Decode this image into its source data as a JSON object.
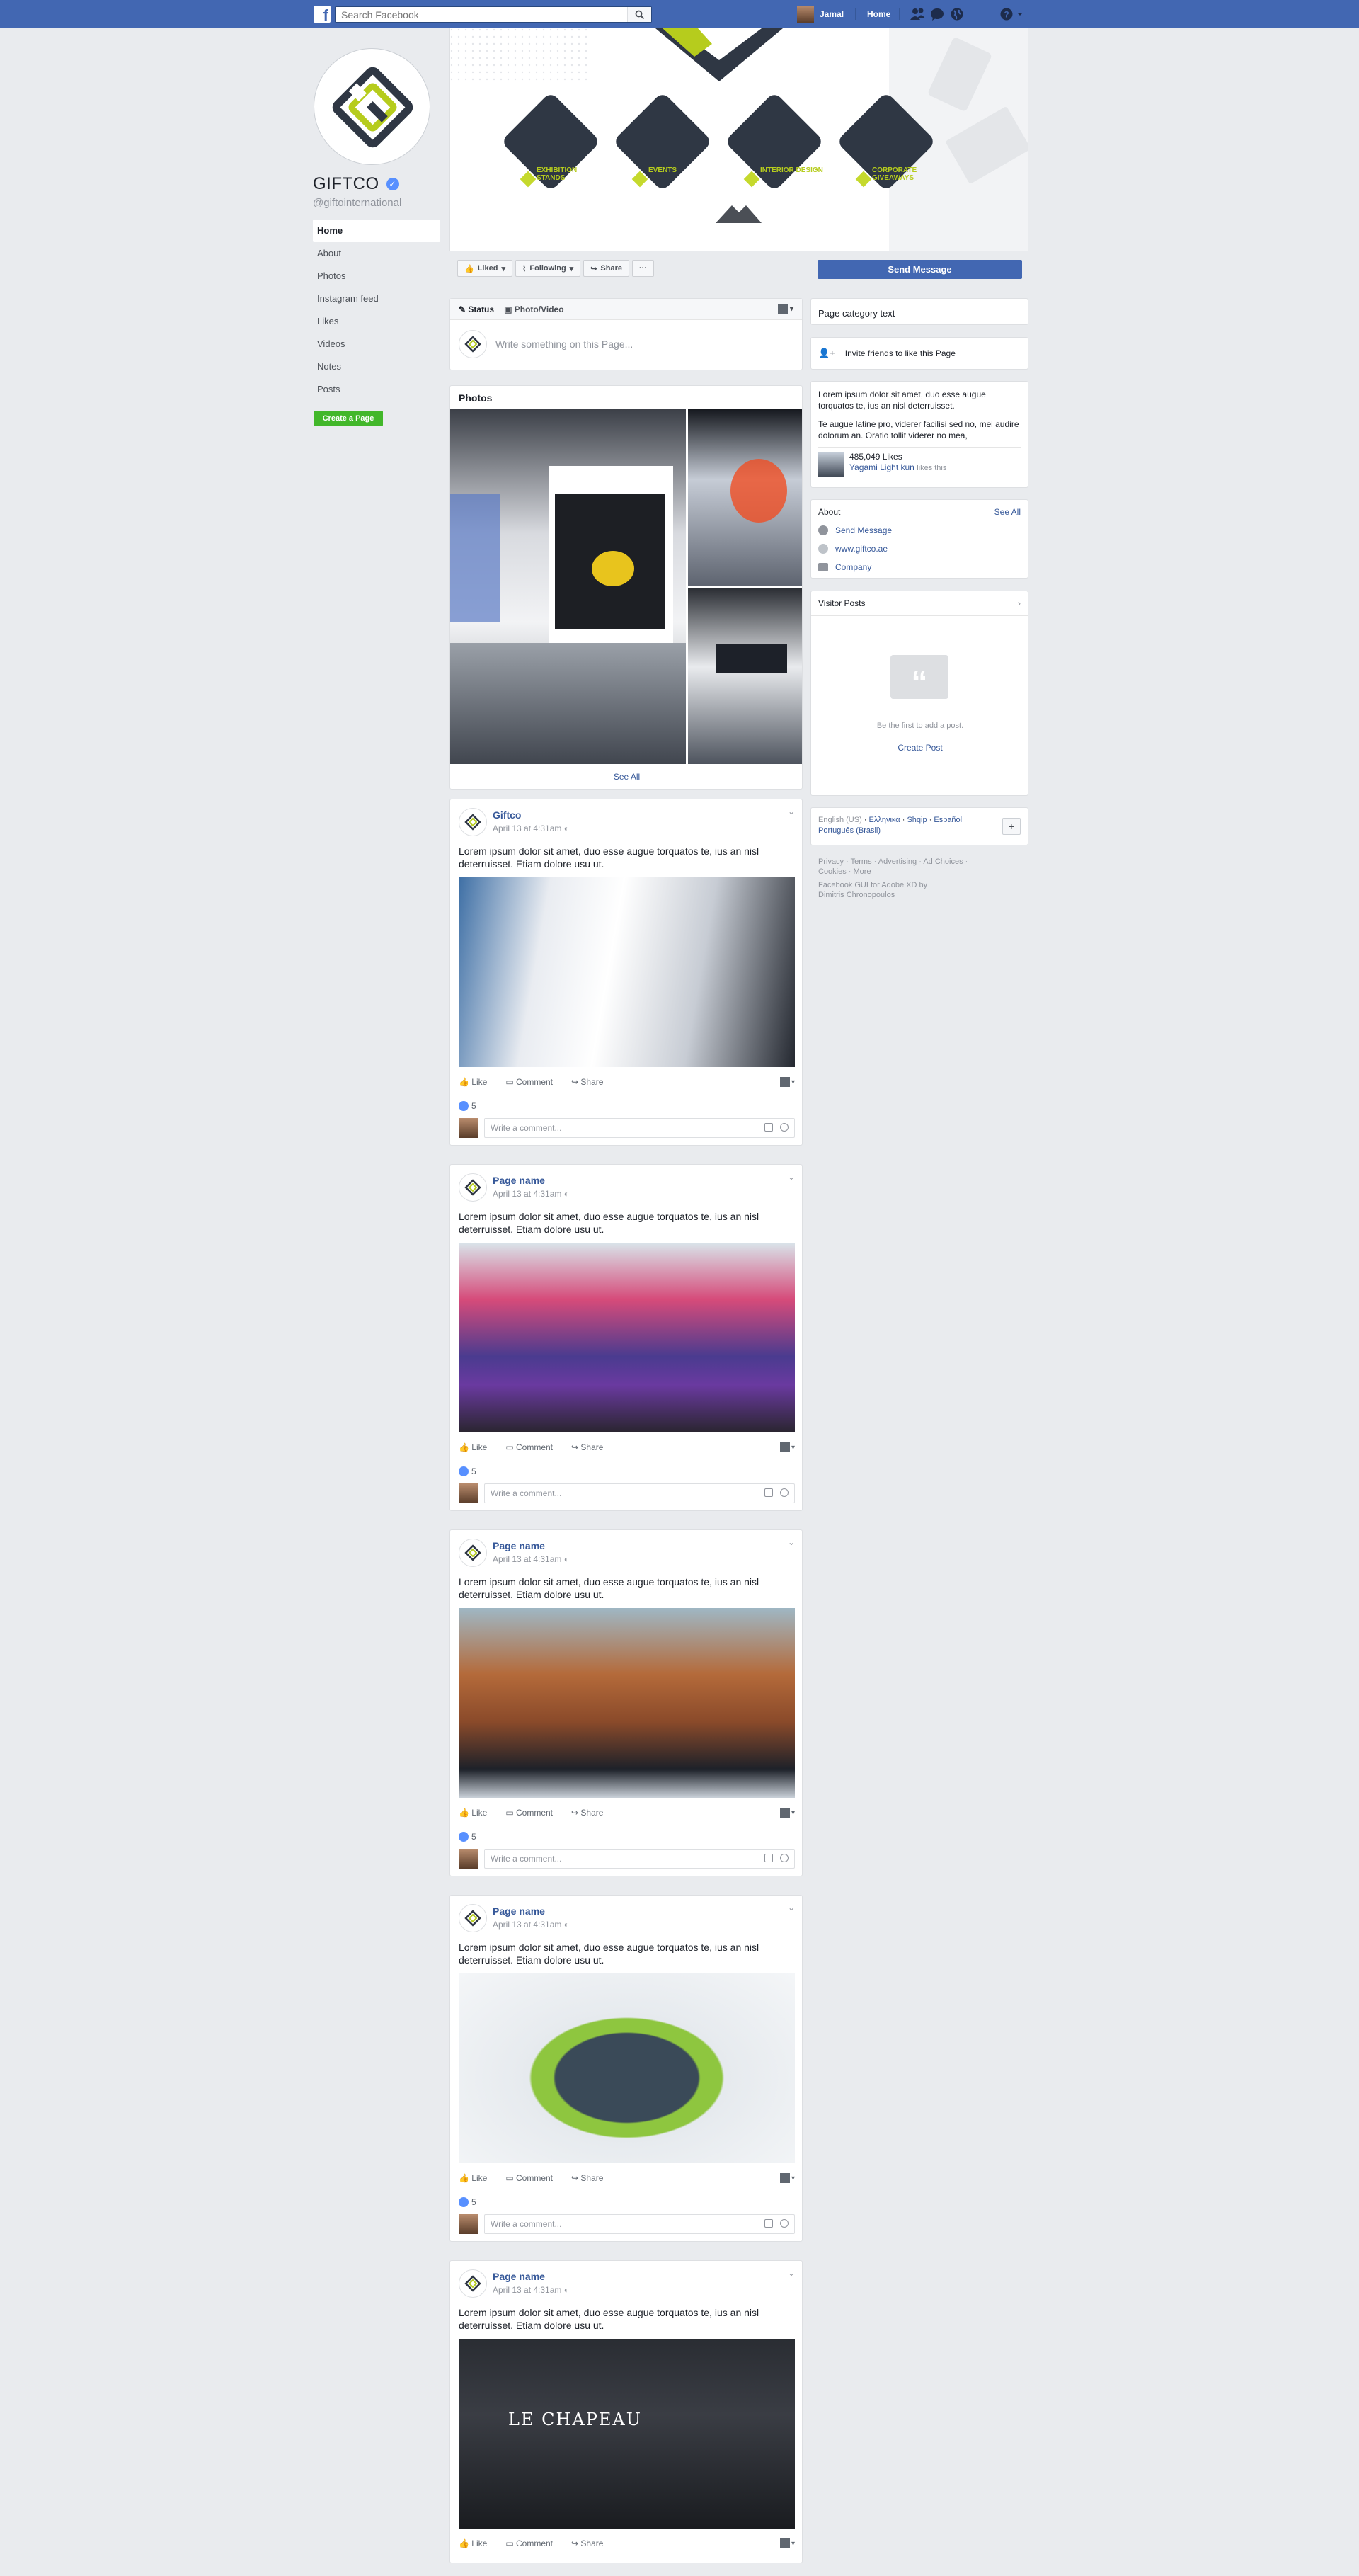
{
  "topbar": {
    "search_placeholder": "Search Facebook",
    "user_name": "Jamal",
    "home_label": "Home"
  },
  "page": {
    "name": "GIFTCO",
    "handle": "@giftointernational"
  },
  "left_nav": [
    {
      "label": "Home",
      "active": true
    },
    {
      "label": "About"
    },
    {
      "label": "Photos"
    },
    {
      "label": "Instagram feed"
    },
    {
      "label": "Likes"
    },
    {
      "label": "Videos"
    },
    {
      "label": "Notes"
    },
    {
      "label": "Posts"
    }
  ],
  "create_page_label": "Create a Page",
  "cover": {
    "services": [
      {
        "label": "EXHIBITION STANDS"
      },
      {
        "label": "EVENTS"
      },
      {
        "label": "INTERIOR DESIGN"
      },
      {
        "label": "CORPORATE GIVEAWAYS"
      }
    ]
  },
  "cover_actions": {
    "liked": "Liked",
    "following": "Following",
    "share": "Share",
    "more": "···",
    "send_message": "Send Message"
  },
  "composer": {
    "tab_status": "Status",
    "tab_photo": "Photo/Video",
    "placeholder": "Write something on this Page..."
  },
  "photos": {
    "title": "Photos",
    "see_all": "See All"
  },
  "posts": [
    {
      "author": "Giftco",
      "time": "April 13 at 4:31am",
      "text": "Lorem ipsum dolor sit amet, duo esse augue torquatos te, ius an nisl deterruisset. Etiam dolore usu ut.",
      "likes": "5",
      "image": "booth"
    },
    {
      "author": "Page name",
      "time": "April 13 at 4:31am",
      "text": "Lorem ipsum dolor sit amet, duo esse augue torquatos te, ius an nisl deterruisset. Etiam dolore usu ut.",
      "likes": "5",
      "image": "stage"
    },
    {
      "author": "Page name",
      "time": "April 13 at 4:31am",
      "text": "Lorem ipsum dolor sit amet, duo esse augue torquatos te, ius an nisl deterruisset. Etiam dolore usu ut.",
      "likes": "5",
      "image": "castle"
    },
    {
      "author": "Page name",
      "time": "April 13 at 4:31am",
      "text": "Lorem ipsum dolor sit amet, duo esse augue torquatos te, ius an nisl deterruisset. Etiam dolore usu ut.",
      "likes": "5",
      "image": "heart"
    },
    {
      "author": "Page name",
      "time": "April 13 at 4:31am",
      "text": "Lorem ipsum dolor sit amet, duo esse augue torquatos te, ius an nisl deterruisset. Etiam dolore usu ut.",
      "likes": "",
      "image": "chapeau"
    }
  ],
  "post_actions": {
    "like": "Like",
    "comment": "Comment",
    "share": "Share",
    "comment_placeholder": "Write a comment..."
  },
  "chapeau_sign": "LE CHAPEAU",
  "right": {
    "category": "Page category text",
    "invite": "Invite friends to like this Page",
    "about_text_1": "Lorem ipsum dolor sit amet, duo esse augue torquatos te, ius an nisl deterruisset.",
    "about_text_2": "Te augue latine pro, viderer facilisi sed no, mei audire dolorum an. Oratio tollit viderer no mea,",
    "likes_count": "485,049 Likes",
    "liker_name": "Yagami Light kun",
    "liker_suffix": "likes this",
    "about_title": "About",
    "see_all": "See All",
    "about_items": [
      "Send Message",
      "www.giftco.ae",
      "Company"
    ],
    "visitor_posts": "Visitor Posts",
    "visitor_empty": "Be the first to add a post.",
    "create_post": "Create Post",
    "languages": {
      "current": "English (US)",
      "others": [
        "Ελληνικά",
        "Shqip",
        "Español",
        "Português (Brasil)"
      ]
    },
    "footer_links": "Privacy · Terms · Advertising · Ad Choices · Cookies · More",
    "credit": "Facebook GUI for Adobe XD by Dimitris Chronopoulos"
  },
  "colors": {
    "brand": "#4267b2",
    "accent_lime": "#b6cc1d",
    "navy": "#2f3744",
    "create_green": "#42b72a"
  }
}
